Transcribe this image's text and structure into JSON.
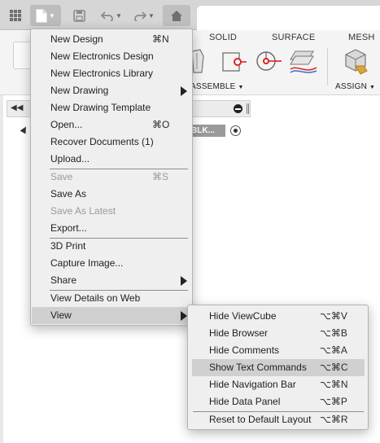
{
  "ribbon": {
    "tabs": [
      "SOLID",
      "SURFACE",
      "MESH"
    ],
    "groups": [
      "ASSEMBLE",
      "ASSIGN"
    ]
  },
  "browser": {
    "chip_text": "BLK..."
  },
  "file_menu": {
    "items": [
      {
        "label": "New Design",
        "shortcut": "⌘N"
      },
      {
        "label": "New Electronics Design",
        "shortcut": ""
      },
      {
        "label": "New Electronics Library",
        "shortcut": ""
      },
      {
        "label": "New Drawing",
        "shortcut": ""
      },
      {
        "label": "New Drawing Template",
        "shortcut": ""
      },
      {
        "label": "Open...",
        "shortcut": "⌘O"
      },
      {
        "label": "Recover Documents (1)",
        "shortcut": ""
      },
      {
        "label": "Upload...",
        "shortcut": ""
      },
      {
        "label": "Save",
        "shortcut": "⌘S"
      },
      {
        "label": "Save As",
        "shortcut": ""
      },
      {
        "label": "Save As Latest",
        "shortcut": ""
      },
      {
        "label": "Export...",
        "shortcut": ""
      },
      {
        "label": "3D Print",
        "shortcut": ""
      },
      {
        "label": "Capture Image...",
        "shortcut": ""
      },
      {
        "label": "Share",
        "shortcut": ""
      },
      {
        "label": "View Details on Web",
        "shortcut": ""
      },
      {
        "label": "View",
        "shortcut": ""
      }
    ]
  },
  "view_menu": {
    "items": [
      {
        "label": "Hide ViewCube",
        "shortcut": "⌥⌘V"
      },
      {
        "label": "Hide Browser",
        "shortcut": "⌥⌘B"
      },
      {
        "label": "Hide Comments",
        "shortcut": "⌥⌘A"
      },
      {
        "label": "Show Text Commands",
        "shortcut": "⌥⌘C"
      },
      {
        "label": "Hide Navigation Bar",
        "shortcut": "⌥⌘N"
      },
      {
        "label": "Hide Data Panel",
        "shortcut": "⌥⌘P"
      },
      {
        "label": "Reset to Default Layout",
        "shortcut": "⌥⌘R"
      }
    ]
  }
}
